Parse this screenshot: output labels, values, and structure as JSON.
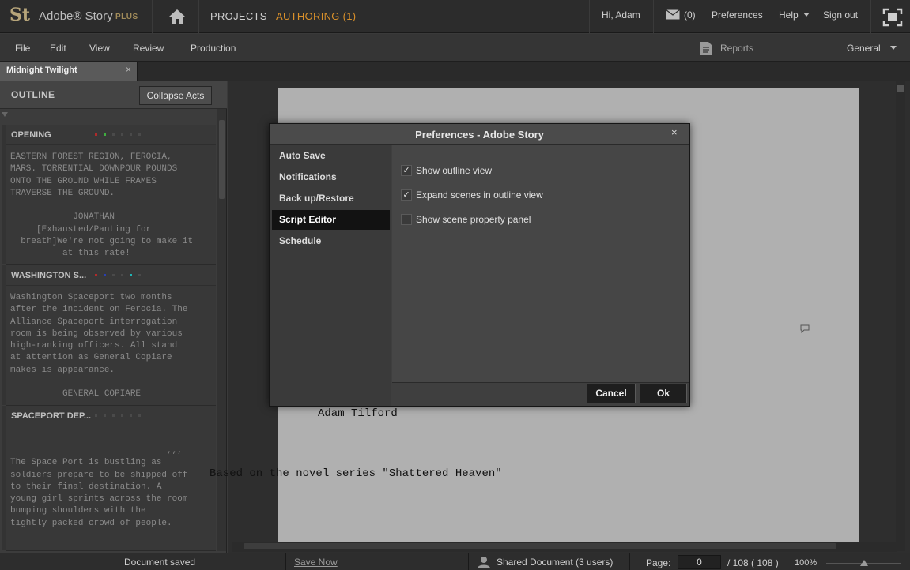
{
  "app": {
    "logo": "St",
    "brand": "Adobe® Story",
    "brand_tier": "PLUS"
  },
  "topnav": {
    "projects": "PROJECTS",
    "authoring": "AUTHORING (1)",
    "greeting": "Hi, Adam",
    "mail_count": "(0)",
    "preferences": "Preferences",
    "help": "Help",
    "sign_out": "Sign out"
  },
  "menubar": {
    "items": [
      "File",
      "Edit",
      "View",
      "Review",
      "Production"
    ],
    "reports": "Reports",
    "workspace": "General"
  },
  "document_tab": {
    "label": "Midnight Twilight",
    "close": "×"
  },
  "outline": {
    "title": "OUTLINE",
    "collapse_button": "Collapse Acts",
    "scenes": [
      {
        "title": "OPENING",
        "text": "EASTERN FOREST REGION, FEROCIA,\nMARS. TORRENTIAL DOWNPOUR POUNDS\nONTO THE GROUND WHILE FRAMES\nTRAVERSE THE GROUND.\n\n            JONATHAN\n     [Exhausted/Panting for\n  breath]We're not going to make it\n          at this rate!"
      },
      {
        "title": "WASHINGTON S...",
        "text": "Washington Spaceport two months\nafter the incident on Ferocia. The\nAlliance Spaceport interrogation\nroom is being observed by various\nhigh-ranking officers. All stand\nat attention as General Copiare\nmakes is appearance.\n\n          GENERAL COPIARE"
      },
      {
        "title": "SPACEPORT DEP...",
        "text": "                              ,,,\nThe Space Port is bustling as\nsoldiers prepare to be shipped off\nto their final destination. A\nyoung girl sprints across the room\nbumping shoulders with the\ntightly packed crowd of people."
      }
    ]
  },
  "script_page": {
    "author": "Adam Tilford",
    "based_on": "Based on the novel series \"Shattered Heaven\""
  },
  "preferences_dialog": {
    "title": "Preferences - Adobe Story",
    "close": "×",
    "nav": [
      "Auto Save",
      "Notifications",
      "Back up/Restore",
      "Script Editor",
      "Schedule"
    ],
    "active_nav": "Script Editor",
    "options": [
      {
        "label": "Show outline view",
        "checked": true
      },
      {
        "label": "Expand scenes in outline view",
        "checked": true
      },
      {
        "label": "Show scene property panel",
        "checked": false
      }
    ],
    "cancel": "Cancel",
    "ok": "Ok"
  },
  "statusbar": {
    "status": "Document saved",
    "save_now": "Save Now",
    "shared": "Shared Document (3 users)",
    "page_label": "Page:",
    "page_value": "0",
    "page_total": "/ 108 ( 108 )",
    "zoom": "100%"
  },
  "colors": {
    "accent_orange": "#d9902a",
    "logo_gold": "#b7a57a",
    "scene_dot_red": "#b02a2a",
    "scene_dot_green": "#3fae3f",
    "scene_dot_blue": "#2a3fb0",
    "scene_dot_teal": "#1fb5b5"
  }
}
